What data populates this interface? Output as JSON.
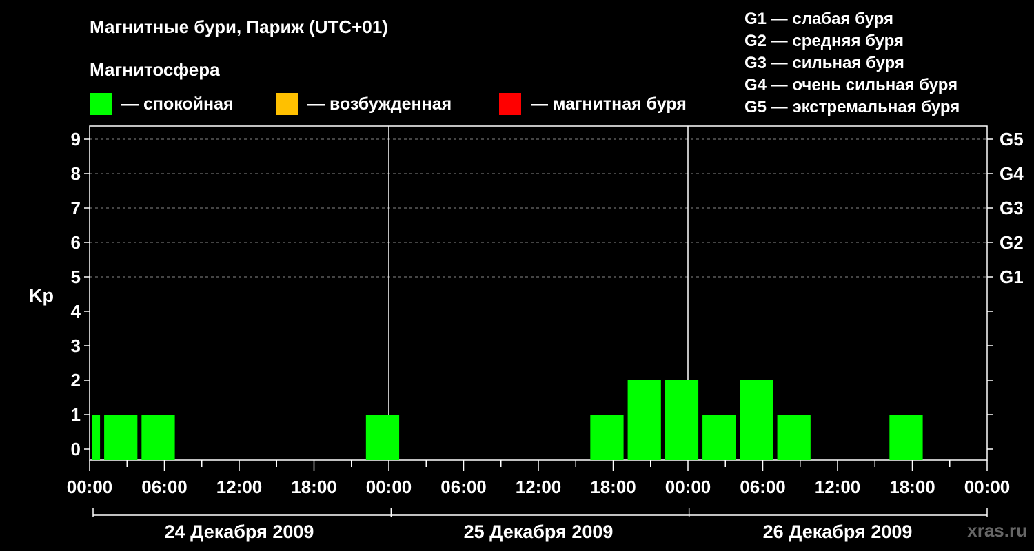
{
  "chart_data": {
    "type": "bar",
    "title": "Магнитные бури, Париж (UTC+01)",
    "subtitle": "Магнитосфера",
    "ylabel": "Kp",
    "ylim": [
      0,
      9
    ],
    "yticks": [
      "0",
      "1",
      "2",
      "3",
      "4",
      "5",
      "6",
      "7",
      "8",
      "9"
    ],
    "xlim": [
      "2009-12-24 00:00",
      "2009-12-27 00:00"
    ],
    "xtick_labels": [
      "00:00",
      "06:00",
      "12:00",
      "18:00",
      "00:00",
      "06:00",
      "12:00",
      "18:00",
      "00:00",
      "06:00",
      "12:00",
      "18:00",
      "00:00"
    ],
    "days": [
      "24 Декабря 2009",
      "25 Декабря 2009",
      "26 Декабря 2009"
    ],
    "right_axis": [
      {
        "kp": 5,
        "label": "G1"
      },
      {
        "kp": 6,
        "label": "G2"
      },
      {
        "kp": 7,
        "label": "G3"
      },
      {
        "kp": 8,
        "label": "G4"
      },
      {
        "kp": 9,
        "label": "G5"
      }
    ],
    "bars": [
      {
        "start": "2009-12-24 00:00",
        "end": "2009-12-24 01:00",
        "kp": 1,
        "state": "calm"
      },
      {
        "start": "2009-12-24 01:00",
        "end": "2009-12-24 04:00",
        "kp": 1,
        "state": "calm"
      },
      {
        "start": "2009-12-24 04:00",
        "end": "2009-12-24 07:00",
        "kp": 1,
        "state": "calm"
      },
      {
        "start": "2009-12-24 22:00",
        "end": "2009-12-25 01:00",
        "kp": 1,
        "state": "calm"
      },
      {
        "start": "2009-12-25 16:00",
        "end": "2009-12-25 19:00",
        "kp": 1,
        "state": "calm"
      },
      {
        "start": "2009-12-25 19:00",
        "end": "2009-12-25 22:00",
        "kp": 2,
        "state": "calm"
      },
      {
        "start": "2009-12-25 22:00",
        "end": "2009-12-26 01:00",
        "kp": 2,
        "state": "calm"
      },
      {
        "start": "2009-12-26 01:00",
        "end": "2009-12-26 04:00",
        "kp": 1,
        "state": "calm"
      },
      {
        "start": "2009-12-26 04:00",
        "end": "2009-12-26 07:00",
        "kp": 2,
        "state": "calm"
      },
      {
        "start": "2009-12-26 07:00",
        "end": "2009-12-26 10:00",
        "kp": 1,
        "state": "calm"
      },
      {
        "start": "2009-12-26 16:00",
        "end": "2009-12-26 19:00",
        "kp": 1,
        "state": "calm"
      }
    ],
    "legend": [
      {
        "key": "calm",
        "label": "— спокойная",
        "color": "#00ff00"
      },
      {
        "key": "excited",
        "label": "— возбужденная",
        "color": "#ffc000"
      },
      {
        "key": "storm",
        "label": "— магнитная буря",
        "color": "#ff0000"
      }
    ],
    "storm_scale": [
      "G1 — слабая буря",
      "G2 — средняя буря",
      "G3 — сильная буря",
      "G4 — очень сильная буря",
      "G5 — экстремальная буря"
    ],
    "grid": "dashed horizontal at Kp 5–9",
    "legend_position": "top"
  },
  "watermark": "xras.ru"
}
